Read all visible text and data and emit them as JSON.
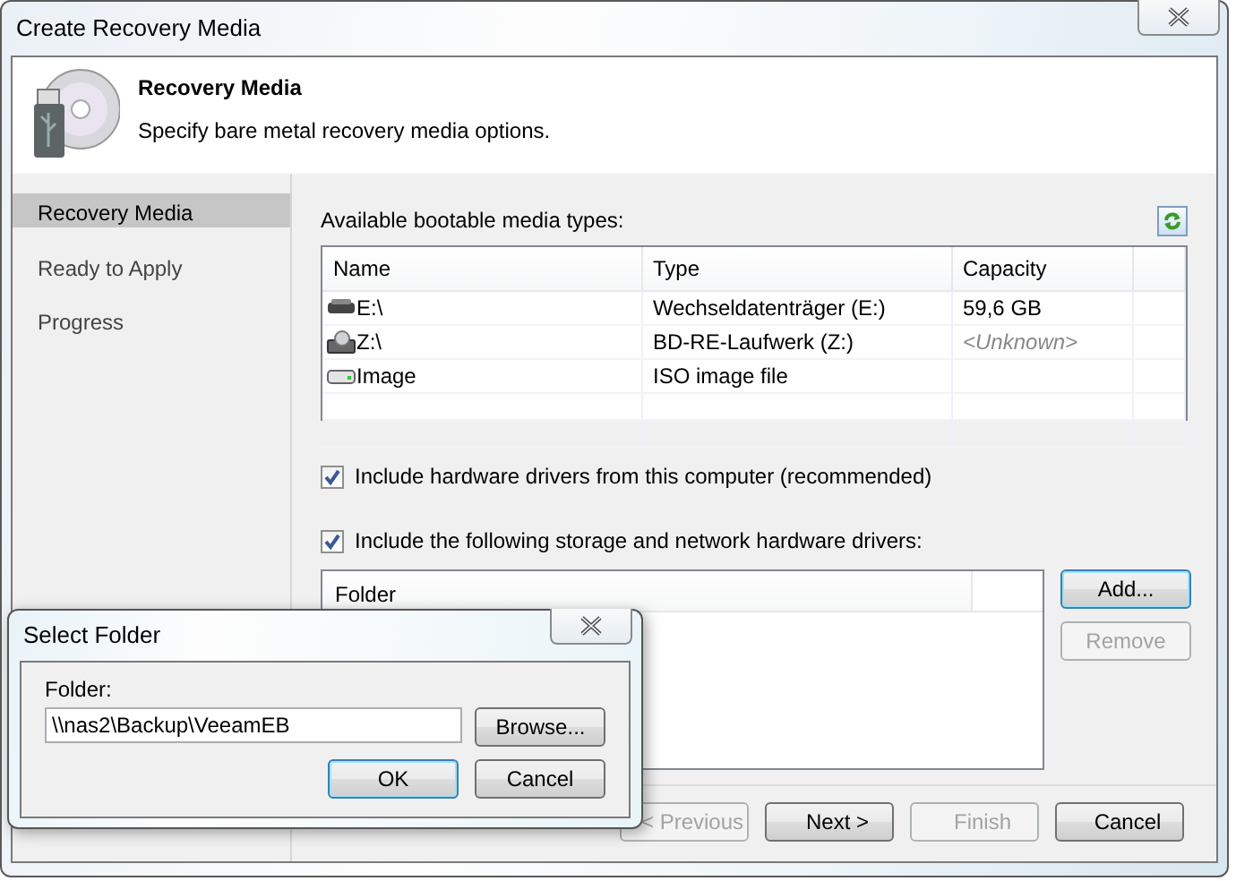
{
  "window": {
    "title": "Create Recovery Media"
  },
  "header": {
    "title": "Recovery Media",
    "subtitle": "Specify bare metal recovery media options."
  },
  "steps": [
    {
      "label": "Recovery Media",
      "selected": true
    },
    {
      "label": "Ready to Apply",
      "selected": false
    },
    {
      "label": "Progress",
      "selected": false
    }
  ],
  "media": {
    "label": "Available bootable media types:",
    "columns": [
      "Name",
      "Type",
      "Capacity"
    ],
    "rows": [
      {
        "kind": "removable",
        "name": "E:\\",
        "type": "Wechseldatenträger (E:)",
        "capacity": "59,6 GB",
        "muted": false
      },
      {
        "kind": "optical",
        "name": "Z:\\",
        "type": "BD-RE-Laufwerk (Z:)",
        "capacity": "<Unknown>",
        "muted": true
      },
      {
        "kind": "image",
        "name": "Image",
        "type": "ISO image file"
      }
    ]
  },
  "options": [
    {
      "label": "Include hardware drivers from this computer (recommended)",
      "checked": true
    },
    {
      "label": "Include the following storage and network hardware drivers:",
      "checked": true
    }
  ],
  "drivers": {
    "columns": [
      "Folder"
    ],
    "buttons": [
      {
        "label": "Add...",
        "disabled": false,
        "focused": true
      },
      {
        "label": "Remove",
        "disabled": true,
        "focused": false
      }
    ]
  },
  "nav_buttons": [
    {
      "label": "< Previous",
      "disabled": true
    },
    {
      "label": "Next >",
      "disabled": false
    },
    {
      "label": "Finish",
      "disabled": true
    },
    {
      "label": "Cancel",
      "disabled": false
    }
  ],
  "dialog": {
    "title": "Select Folder",
    "field_label": "Folder:",
    "value": "\\\\nas2\\Backup\\VeeamEB",
    "buttons": [
      {
        "label": "Browse...",
        "default": false
      },
      {
        "label": "OK",
        "default": true
      },
      {
        "label": "Cancel",
        "default": false
      }
    ]
  }
}
